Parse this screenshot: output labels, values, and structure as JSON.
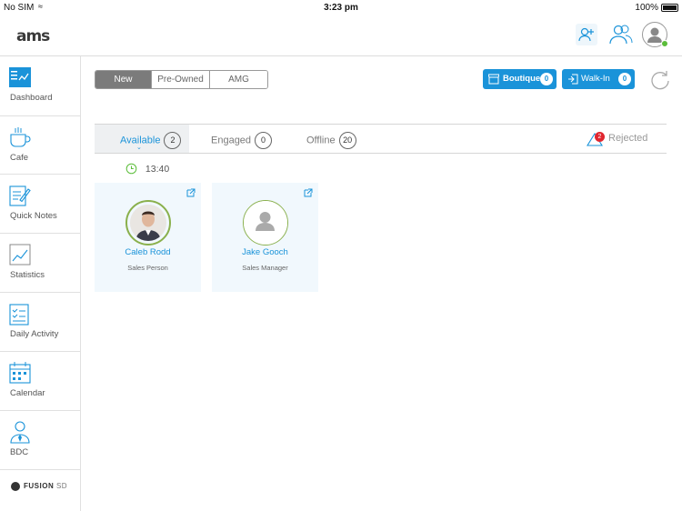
{
  "status_bar": {
    "carrier": "No SIM",
    "time": "3:23 pm",
    "battery": "100%"
  },
  "header": {
    "logo": "ams"
  },
  "sidebar": {
    "items": [
      {
        "label": "Dashboard",
        "icon": "dashboard-icon"
      },
      {
        "label": "Cafe",
        "icon": "coffee-cup-icon"
      },
      {
        "label": "Quick Notes",
        "icon": "notes-pencil-icon"
      },
      {
        "label": "Statistics",
        "icon": "chart-icon"
      },
      {
        "label": "Daily Activity",
        "icon": "checklist-icon"
      },
      {
        "label": "Calendar",
        "icon": "calendar-icon"
      },
      {
        "label": "BDC",
        "icon": "person-tie-icon"
      }
    ],
    "footer": {
      "brand": "FUSION",
      "suffix": "SD"
    }
  },
  "segments": {
    "items": [
      "New",
      "Pre-Owned",
      "AMG"
    ],
    "selected": "New"
  },
  "actions": {
    "boutique": {
      "label": "Boutique",
      "count": "0"
    },
    "walkin": {
      "label": "Walk-In",
      "count": "0"
    }
  },
  "tabs": [
    {
      "label": "Available",
      "count": "2"
    },
    {
      "label": "Engaged",
      "count": "0"
    },
    {
      "label": "Offline",
      "count": "20"
    }
  ],
  "rejected": {
    "label": "Rejected",
    "count": "2"
  },
  "queue": {
    "time": "13:40"
  },
  "cards": [
    {
      "name": "Caleb  Rodd",
      "role": "Sales Person"
    },
    {
      "name": "Jake Gooch",
      "role": "Sales Manager"
    }
  ],
  "colors": {
    "accent": "#1a93d9",
    "ring": "#8ab04c",
    "alert": "#e0262f",
    "online": "#5bbd3a"
  }
}
